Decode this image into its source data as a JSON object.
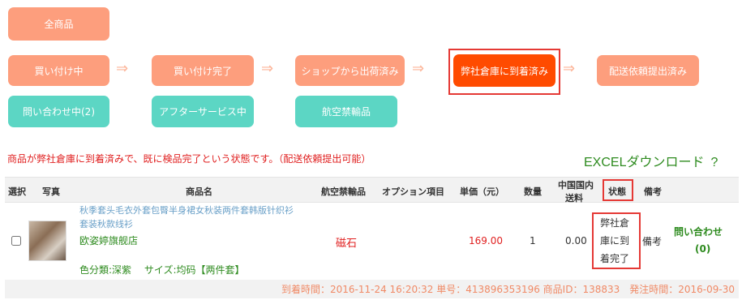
{
  "status_buttons": {
    "all": "全商品",
    "buying": "買い付け中",
    "buy_done": "買い付け完了",
    "shop_shipped": "ショップから出荷済み",
    "arrived": "弊社倉庫に到着済み",
    "delivery_req": "配送依頼提出済み",
    "inquiry": "問い合わせ中(2)",
    "after_service": "アフターサービス中",
    "air_prohibited": "航空禁輸品"
  },
  "arrow_glyph": "⇒",
  "notice": "商品が弊社倉庫に到着済みで、既に検品完了という状態です。（配送依頼提出可能）",
  "excel": {
    "label": "EXCELダウンロード",
    "help": "?"
  },
  "table": {
    "headers": {
      "select": "選択",
      "photo": "写真",
      "name": "商品名",
      "prohibited": "航空禁輸品",
      "option": "オプション項目",
      "unit_price": "単価（元）",
      "qty": "数量",
      "domestic_shipping_1": "中国国内",
      "domestic_shipping_2": "送料",
      "status": "状態",
      "remarks": "備考"
    },
    "row": {
      "title_1": "秋季套头毛衣外套包臀半身裙女秋装两件套韩版针织衫",
      "title_2": "套装秋款线衫",
      "shop": "欧姿婷旗舰店",
      "variant": "色分類:深紫　 サイズ:均码【两件套】",
      "prohibited": "磁石",
      "unit_price": "169.00",
      "qty": "1",
      "shipping": "0.00",
      "status_1": "弊社倉",
      "status_2": "庫に到",
      "status_3": "着完了",
      "remarks": "備考",
      "inquiry_1": "問い合わせ",
      "inquiry_2": "(0)"
    },
    "footer": "到着時間：2016-11-24 16:20:32 単号：413896353196 商品ID：138833　発注時間：2016-09-30"
  },
  "colors": {
    "orange": "#fd9e7d",
    "teal": "#5cd6c4",
    "active": "#ff4b00",
    "highlight_box": "#e53935",
    "green": "#2e8b1f",
    "red_text": "#e02020"
  }
}
